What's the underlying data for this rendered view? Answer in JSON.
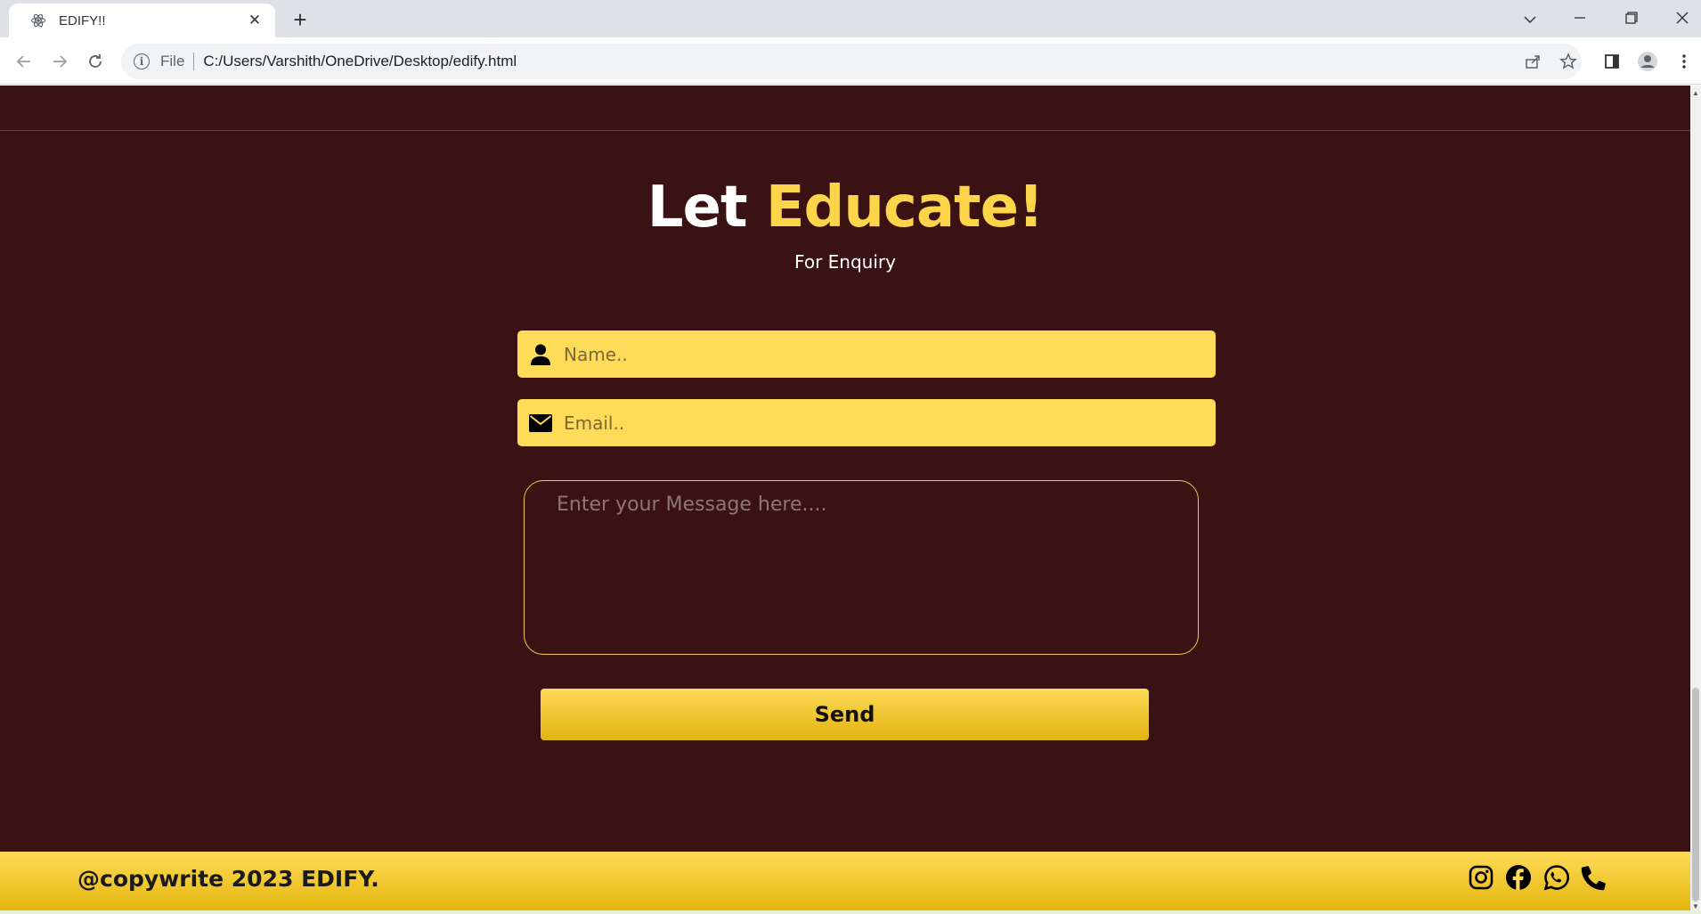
{
  "browser": {
    "tab_title": "EDIFY!!",
    "tab_close": "✕",
    "new_tab": "+",
    "scheme_label": "File",
    "url": "C:/Users/Varshith/OneDrive/Desktop/edify.html"
  },
  "page": {
    "title_part1": "Let ",
    "title_part2": "Educate!",
    "subtitle": "For Enquiry",
    "name_placeholder": "Name..",
    "email_placeholder": "Email..",
    "message_placeholder": "Enter your Message here....",
    "send_label": "Send"
  },
  "footer": {
    "copyright": "@copywrite 2023 EDIFY.",
    "social_icons": [
      "instagram-icon",
      "facebook-icon",
      "whatsapp-icon",
      "phone-icon"
    ]
  },
  "colors": {
    "background": "#3a1214",
    "accent_yellow": "#fedb58",
    "title_accent": "#fdd54a"
  }
}
